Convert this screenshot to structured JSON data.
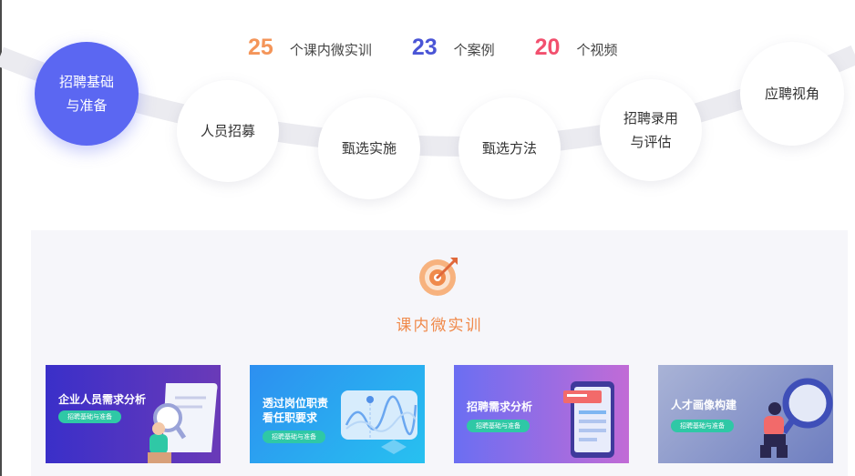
{
  "stats": [
    {
      "number": "25",
      "label": "个课内微实训",
      "color": "#f49559"
    },
    {
      "number": "23",
      "label": "个案例",
      "color": "#4a55d6"
    },
    {
      "number": "20",
      "label": "个视频",
      "color": "#f2506e"
    }
  ],
  "nodes": [
    {
      "line1": "招聘基础",
      "line2": "与准备",
      "active": true
    },
    {
      "line1": "人员招募",
      "line2": ""
    },
    {
      "line1": "甄选实施",
      "line2": ""
    },
    {
      "line1": "甄选方法",
      "line2": ""
    },
    {
      "line1": "招聘录用",
      "line2": "与评估"
    },
    {
      "line1": "应聘视角",
      "line2": ""
    }
  ],
  "section": {
    "title": "课内微实训",
    "icon": "target-icon"
  },
  "cards": [
    {
      "title_line1": "企业人员需求分析",
      "title_line2": "",
      "tag": "招聘基础与准备",
      "art": "magnifier-document-icon"
    },
    {
      "title_line1": "透过岗位职责",
      "title_line2": "看任职要求",
      "tag": "招聘基础与准备",
      "art": "line-chart-icon"
    },
    {
      "title_line1": "招聘需求分析",
      "title_line2": "",
      "tag": "招聘基础与准备",
      "art": "mobile-form-icon"
    },
    {
      "title_line1": "人才画像构建",
      "title_line2": "",
      "tag": "招聘基础与准备",
      "art": "person-magnifier-icon"
    }
  ],
  "colors": {
    "accent": "#5b67f2",
    "orange": "#f08a4b",
    "tag_green": "#2fc8a6",
    "panel_bg": "#f6f6fa"
  }
}
